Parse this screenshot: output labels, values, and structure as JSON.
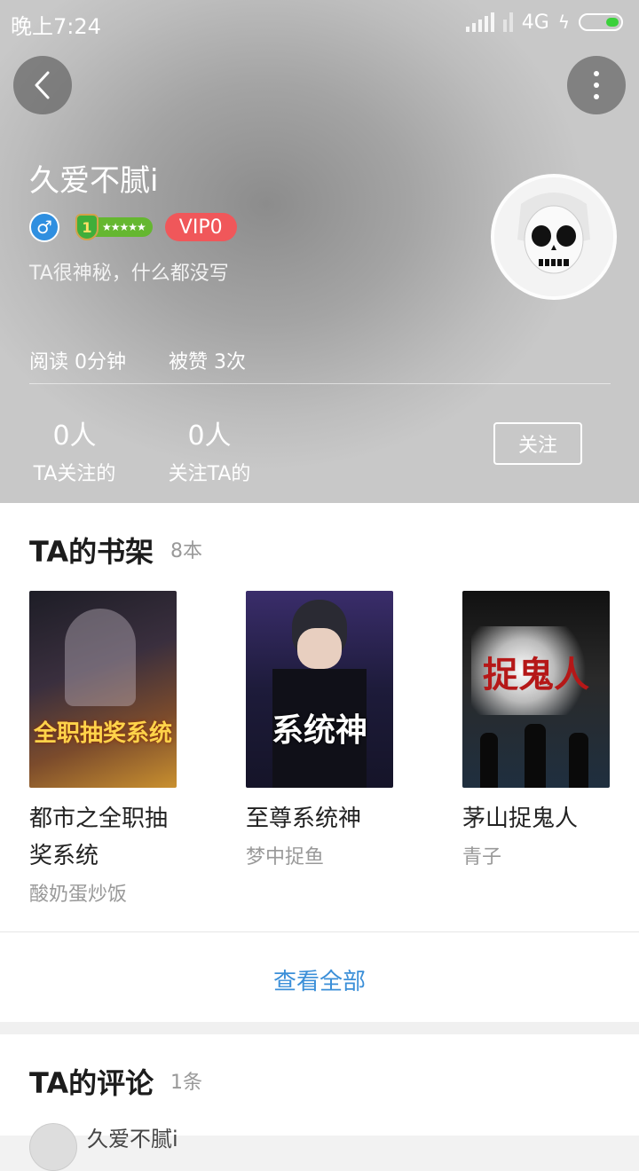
{
  "status_bar": {
    "time": "晚上7:24",
    "network": "4G"
  },
  "profile": {
    "username": "久爱不腻i",
    "gender_symbol": "♂",
    "level": "1",
    "level_stars": "★★★★★",
    "vip": "VIP0",
    "bio": "TA很神秘，什么都没写",
    "read_label": "阅读",
    "read_value": "0分钟",
    "liked_label": "被赞",
    "liked_value": "3次",
    "following_count": "0人",
    "following_label": "TA关注的",
    "followers_count": "0人",
    "followers_label": "关注TA的",
    "follow_button": "关注"
  },
  "bookshelf": {
    "title": "TA的书架",
    "count": "8本",
    "books": [
      {
        "title": "都市之全职抽奖系统",
        "author": "酸奶蛋炒饭",
        "cover_text": "全职抽奖系统"
      },
      {
        "title": "至尊系统神",
        "author": "梦中捉鱼",
        "cover_text": "系统神"
      },
      {
        "title": "茅山捉鬼人",
        "author": "青子",
        "cover_text": "捉鬼人"
      }
    ],
    "view_all": "查看全部"
  },
  "comments": {
    "title": "TA的评论",
    "count": "1条",
    "first_user": "久爱不腻i"
  },
  "colors": {
    "vip_badge": "#f0575a",
    "gender_badge": "#2f8fe0",
    "level_bar": "#65b730",
    "link": "#3b8fd8"
  }
}
